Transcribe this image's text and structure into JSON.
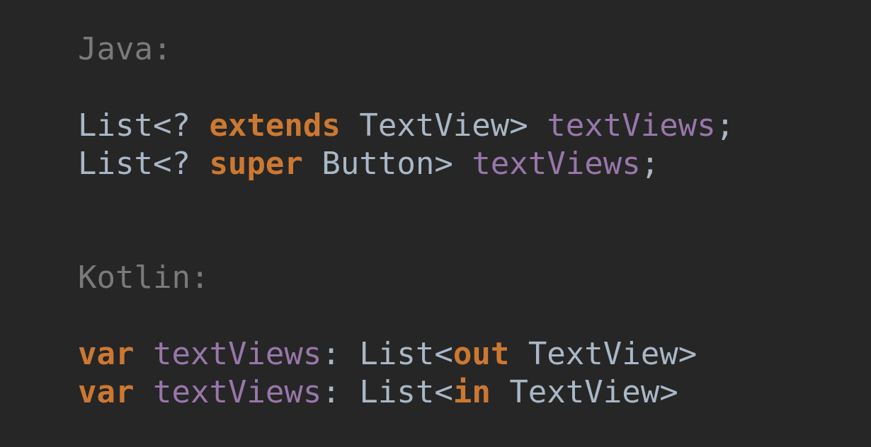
{
  "java": {
    "header": "Java:",
    "line1": {
      "a": "List<? ",
      "kw": "extends",
      "b": " TextView> ",
      "var": "textViews",
      "c": ";"
    },
    "line2": {
      "a": "List<? ",
      "kw": "super",
      "b": " Button> ",
      "var": "textViews",
      "c": ";"
    }
  },
  "kotlin": {
    "header": "Kotlin:",
    "line1": {
      "kw1": "var",
      "sp": " ",
      "var": "textViews",
      "a": ": List<",
      "kw2": "out",
      "b": " TextView>"
    },
    "line2": {
      "kw1": "var",
      "sp": " ",
      "var": "textViews",
      "a": ": List<",
      "kw2": "in",
      "b": " TextView>"
    }
  },
  "colors": {
    "background": "#262626",
    "comment": "#7a7a7a",
    "keyword": "#cc7832",
    "identifier": "#9876aa",
    "plain": "#a9b7c6"
  }
}
